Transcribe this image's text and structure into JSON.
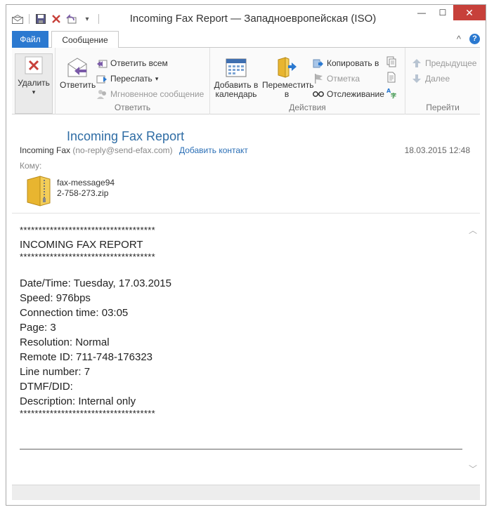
{
  "window": {
    "title": "Incoming Fax Report — Западноевропейская (ISO)",
    "minimize": "—",
    "maximize": "☐",
    "close": "✕"
  },
  "qat": {
    "undo_icon": "↶"
  },
  "tabs": {
    "file": "Файл",
    "message": "Сообщение",
    "collapse": "^"
  },
  "ribbon": {
    "delete": {
      "label": "Удалить",
      "arrow": "▾"
    },
    "reply": {
      "label": "Ответить"
    },
    "reply_all": "Ответить всем",
    "forward": "Переслать",
    "forward_arrow": "▾",
    "im": "Мгновенное сообщение",
    "group_respond": "Ответить",
    "add_calendar_1": "Добавить в",
    "add_calendar_2": "календарь",
    "move_1": "Переместить",
    "move_2": "в",
    "copy_to": "Копировать в",
    "mark": "Отметка",
    "tracking": "Отслеживание",
    "group_actions": "Действия",
    "previous": "Предыдущее",
    "next": "Далее",
    "group_goto": "Перейти"
  },
  "message": {
    "subject": "Incoming Fax Report",
    "from_name": "Incoming Fax",
    "from_addr": "(no-reply@send-efax.com)",
    "add_contact": "Добавить контакт",
    "date": "18.03.2015 12:48",
    "to_label": "Кому:",
    "attachment": "fax-message942-758-273.zip",
    "body": {
      "stars1": "************************************",
      "heading": "INCOMING FAX REPORT",
      "stars2": "************************************",
      "date_time": "Date/Time: Tuesday, 17.03.2015",
      "speed": "Speed: 976bps",
      "connection_time": "Connection time: 03:05",
      "page": "Page: 3",
      "resolution": "Resolution: Normal",
      "remote_id": "Remote ID: 711-748-176323",
      "line_number": "Line number: 7",
      "dtmf": "DTMF/DID:",
      "description": "Description: Internal only",
      "stars3": "************************************"
    }
  },
  "scroll": {
    "up": "︿",
    "down": "﹀"
  },
  "colors": {
    "accent": "#2b79d0",
    "close": "#c7403a",
    "subject": "#2e6ca4"
  }
}
